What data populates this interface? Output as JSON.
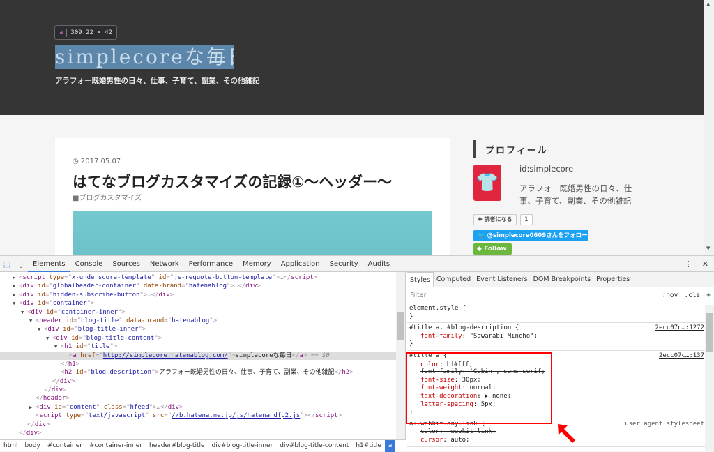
{
  "page": {
    "tooltip": {
      "tag": "a",
      "size": "309.22 × 42"
    },
    "blog_title": "simplecoreな毎日",
    "blog_description": "アラフォー既婚男性の日々、仕事、子育て、副業、その他雑記",
    "post": {
      "date": "2017.05.07",
      "title": "はてなブログカスタマイズの記録①〜ヘッダー〜",
      "category": "ブログカスタマイズ"
    },
    "sidebar": {
      "heading": "プロフィール",
      "user_id": "id:simplecore",
      "bio": "アラフォー既婚男性の日々、仕事、子育て、副業、その他雑記",
      "subscribe_label": "読者になる",
      "subscribe_count": "1",
      "twitter_label": "@simplecore0609さんをフォロー",
      "follow_label": "Follow",
      "avatar_color": "#e0263e"
    }
  },
  "devtools": {
    "tabs": [
      "Elements",
      "Console",
      "Sources",
      "Network",
      "Performance",
      "Memory",
      "Application",
      "Security",
      "Audits"
    ],
    "active_tab": "Elements",
    "dom_lines": [
      {
        "i": 1,
        "a": "▶",
        "p": [
          [
            "tg",
            "<"
          ],
          [
            "tn",
            "script "
          ],
          [
            "an",
            "type"
          ],
          [
            "tg",
            "=\""
          ],
          [
            "av",
            "x-underscore-template"
          ],
          [
            "tg",
            "\" "
          ],
          [
            "an",
            "id"
          ],
          [
            "tg",
            "=\""
          ],
          [
            "av",
            "js-requote-button-template"
          ],
          [
            "tg",
            "\">…</"
          ],
          [
            "tn",
            "script"
          ],
          [
            "tg",
            ">"
          ]
        ]
      },
      {
        "i": 1,
        "a": "▶",
        "p": [
          [
            "tg",
            "<"
          ],
          [
            "tn",
            "div "
          ],
          [
            "an",
            "id"
          ],
          [
            "tg",
            "=\""
          ],
          [
            "av",
            "globalheader-container"
          ],
          [
            "tg",
            "\" "
          ],
          [
            "an",
            "data-brand"
          ],
          [
            "tg",
            "=\""
          ],
          [
            "av",
            "hatenablog"
          ],
          [
            "tg",
            "\">…</"
          ],
          [
            "tn",
            "div"
          ],
          [
            "tg",
            ">"
          ]
        ]
      },
      {
        "i": 1,
        "a": "▶",
        "p": [
          [
            "tg",
            "<"
          ],
          [
            "tn",
            "div "
          ],
          [
            "an",
            "id"
          ],
          [
            "tg",
            "=\""
          ],
          [
            "av",
            "hidden-subscribe-button"
          ],
          [
            "tg",
            "\">…</"
          ],
          [
            "tn",
            "div"
          ],
          [
            "tg",
            ">"
          ]
        ]
      },
      {
        "i": 1,
        "a": "▼",
        "p": [
          [
            "tg",
            "<"
          ],
          [
            "tn",
            "div "
          ],
          [
            "an",
            "id"
          ],
          [
            "tg",
            "=\""
          ],
          [
            "av",
            "container"
          ],
          [
            "tg",
            "\">"
          ]
        ]
      },
      {
        "i": 2,
        "a": "▼",
        "p": [
          [
            "tg",
            "<"
          ],
          [
            "tn",
            "div "
          ],
          [
            "an",
            "id"
          ],
          [
            "tg",
            "=\""
          ],
          [
            "av",
            "container-inner"
          ],
          [
            "tg",
            "\">"
          ]
        ]
      },
      {
        "i": 3,
        "a": "▼",
        "p": [
          [
            "tg",
            "<"
          ],
          [
            "tn",
            "header "
          ],
          [
            "an",
            "id"
          ],
          [
            "tg",
            "=\""
          ],
          [
            "av",
            "blog-title"
          ],
          [
            "tg",
            "\" "
          ],
          [
            "an",
            "data-brand"
          ],
          [
            "tg",
            "=\""
          ],
          [
            "av",
            "hatenablog"
          ],
          [
            "tg",
            "\">"
          ]
        ]
      },
      {
        "i": 4,
        "a": "▼",
        "p": [
          [
            "tg",
            "<"
          ],
          [
            "tn",
            "div "
          ],
          [
            "an",
            "id"
          ],
          [
            "tg",
            "=\""
          ],
          [
            "av",
            "blog-title-inner"
          ],
          [
            "tg",
            "\">"
          ]
        ]
      },
      {
        "i": 5,
        "a": "▼",
        "p": [
          [
            "tg",
            "<"
          ],
          [
            "tn",
            "div "
          ],
          [
            "an",
            "id"
          ],
          [
            "tg",
            "=\""
          ],
          [
            "av",
            "blog-title-content"
          ],
          [
            "tg",
            "\">"
          ]
        ]
      },
      {
        "i": 6,
        "a": "▼",
        "p": [
          [
            "tg",
            "<"
          ],
          [
            "tn",
            "h1 "
          ],
          [
            "an",
            "id"
          ],
          [
            "tg",
            "=\""
          ],
          [
            "av",
            "title"
          ],
          [
            "tg",
            "\">"
          ]
        ]
      },
      {
        "i": 7,
        "a": "",
        "sel": true,
        "p": [
          [
            "tg",
            "<"
          ],
          [
            "tn",
            "a "
          ],
          [
            "an",
            "href"
          ],
          [
            "tg",
            "=\""
          ],
          [
            "lk",
            "http://simplecore.hatenablog.com/"
          ],
          [
            "tg",
            "\">"
          ],
          [
            "tx",
            "simplecoreな毎日"
          ],
          [
            "tg",
            "</"
          ],
          [
            "tn",
            "a"
          ],
          [
            "tg",
            "> "
          ],
          [
            "dl",
            "== $0"
          ]
        ]
      },
      {
        "i": 6,
        "a": "",
        "p": [
          [
            "tg",
            "</"
          ],
          [
            "tn",
            "h1"
          ],
          [
            "tg",
            ">"
          ]
        ]
      },
      {
        "i": 6,
        "a": "",
        "p": [
          [
            "tg",
            "<"
          ],
          [
            "tn",
            "h2 "
          ],
          [
            "an",
            "id"
          ],
          [
            "tg",
            "=\""
          ],
          [
            "av",
            "blog-description"
          ],
          [
            "tg",
            "\">"
          ],
          [
            "tx",
            "アラフォー既婚男性の日々、仕事、子育て、副業、その他雑記"
          ],
          [
            "tg",
            "</"
          ],
          [
            "tn",
            "h2"
          ],
          [
            "tg",
            ">"
          ]
        ]
      },
      {
        "i": 5,
        "a": "",
        "p": [
          [
            "tg",
            "</"
          ],
          [
            "tn",
            "div"
          ],
          [
            "tg",
            ">"
          ]
        ]
      },
      {
        "i": 4,
        "a": "",
        "p": [
          [
            "tg",
            "</"
          ],
          [
            "tn",
            "div"
          ],
          [
            "tg",
            ">"
          ]
        ]
      },
      {
        "i": 3,
        "a": "",
        "p": [
          [
            "tg",
            "</"
          ],
          [
            "tn",
            "header"
          ],
          [
            "tg",
            ">"
          ]
        ]
      },
      {
        "i": 3,
        "a": "▶",
        "p": [
          [
            "tg",
            "<"
          ],
          [
            "tn",
            "div "
          ],
          [
            "an",
            "id"
          ],
          [
            "tg",
            "=\""
          ],
          [
            "av",
            "content"
          ],
          [
            "tg",
            "\" "
          ],
          [
            "an",
            "class"
          ],
          [
            "tg",
            "=\""
          ],
          [
            "av",
            "hfeed"
          ],
          [
            "tg",
            "\">…</"
          ],
          [
            "tn",
            "div"
          ],
          [
            "tg",
            ">"
          ]
        ]
      },
      {
        "i": 3,
        "a": "",
        "p": [
          [
            "tg",
            "<"
          ],
          [
            "tn",
            "script "
          ],
          [
            "an",
            "type"
          ],
          [
            "tg",
            "=\""
          ],
          [
            "av",
            "text/javascript"
          ],
          [
            "tg",
            "\" "
          ],
          [
            "an",
            "src"
          ],
          [
            "tg",
            "=\""
          ],
          [
            "lk",
            "//b.hatena.ne.jp/js/hatena_dfp2.js"
          ],
          [
            "tg",
            "\"></"
          ],
          [
            "tn",
            "script"
          ],
          [
            "tg",
            ">"
          ]
        ]
      },
      {
        "i": 2,
        "a": "",
        "p": [
          [
            "tg",
            "</"
          ],
          [
            "tn",
            "div"
          ],
          [
            "tg",
            ">"
          ]
        ]
      },
      {
        "i": 1,
        "a": "",
        "p": [
          [
            "tg",
            "</"
          ],
          [
            "tn",
            "div"
          ],
          [
            "tg",
            ">"
          ]
        ]
      }
    ],
    "breadcrumb": [
      "html",
      "body",
      "#container",
      "#container-inner",
      "header#blog-title",
      "div#blog-title-inner",
      "div#blog-title-content",
      "h1#title",
      "a"
    ],
    "styles_tabs": [
      "Styles",
      "Computed",
      "Event Listeners",
      "DOM Breakpoints",
      "Properties"
    ],
    "filter_placeholder": "Filter",
    "filter_actions": [
      ":hov",
      ".cls",
      "+"
    ],
    "rules": [
      {
        "selector": "element.style {",
        "src": "",
        "props": [],
        "close": "}"
      },
      {
        "selector": "#title a, #blog-description {",
        "src": "2ecc07c…:1272",
        "props": [
          {
            "n": "font-family",
            "v": "\"Sawarabi Mincho\";"
          }
        ],
        "close": "}"
      },
      {
        "selector": "#title a {",
        "src": "2ecc07c…:137",
        "props": [
          {
            "n": "color",
            "v": "#fff;",
            "swatch": "#ffffff"
          },
          {
            "n": "font-family",
            "v": "'Cabin', sans-serif;",
            "strike": true
          },
          {
            "n": "font-size",
            "v": "30px;"
          },
          {
            "n": "font-weight",
            "v": "normal;"
          },
          {
            "n": "text-decoration",
            "v": "▶ none;"
          },
          {
            "n": "letter-spacing",
            "v": "5px;"
          }
        ],
        "close": "}"
      },
      {
        "selector": "a:-webkit-any-link {",
        "src": "user agent stylesheet",
        "ua": true,
        "props": [
          {
            "n": "color",
            "v": "-webkit-link;",
            "strike": true
          },
          {
            "n": "cursor",
            "v": "auto;"
          }
        ],
        "close": ""
      }
    ]
  }
}
